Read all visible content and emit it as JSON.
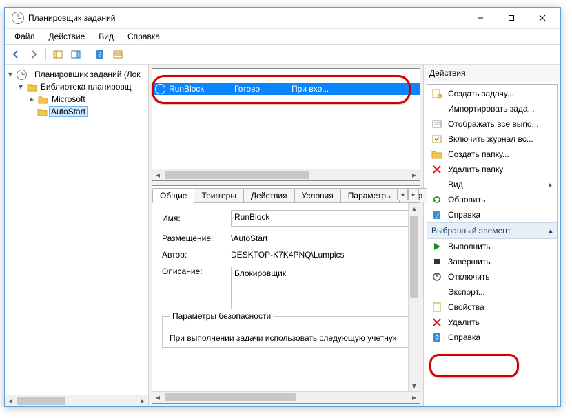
{
  "window": {
    "title": "Планировщик заданий"
  },
  "menu": {
    "file": "Файл",
    "action": "Действие",
    "view": "Вид",
    "help": "Справка"
  },
  "tree": {
    "root": "Планировщик заданий (Лок",
    "library": "Библиотека планировщ",
    "microsoft": "Microsoft",
    "autostart": "AutoStart"
  },
  "tasklist": {
    "row": {
      "name": "RunBlock",
      "status": "Готово",
      "trigger": "При вхо..."
    }
  },
  "tabs": {
    "general": "Общие",
    "triggers": "Триггеры",
    "actions": "Действия",
    "conditions": "Условия",
    "settings": "Параметры",
    "history": "Жур"
  },
  "details": {
    "name_label": "Имя:",
    "name_value": "RunBlock",
    "location_label": "Размещение:",
    "location_value": "\\AutoStart",
    "author_label": "Автор:",
    "author_value": "DESKTOP-K7K4PNQ\\Lumpics",
    "description_label": "Описание:",
    "description_value": "Блокировщик",
    "security_legend": "Параметры безопасности",
    "security_line": "При выполнении задачи использовать следующую учетнук"
  },
  "actions": {
    "header": "Действия",
    "create_task": "Создать задачу...",
    "import_task": "Импортировать зада...",
    "show_running": "Отображать все выпо...",
    "enable_history": "Включить журнал вс...",
    "new_folder": "Создать папку...",
    "delete_folder": "Удалить папку",
    "view": "Вид",
    "refresh": "Обновить",
    "help": "Справка",
    "section_selected": "Выбранный элемент",
    "run": "Выполнить",
    "end": "Завершить",
    "disable": "Отключить",
    "export": "Экспорт...",
    "properties": "Свойства",
    "delete": "Удалить",
    "help2": "Справка"
  }
}
